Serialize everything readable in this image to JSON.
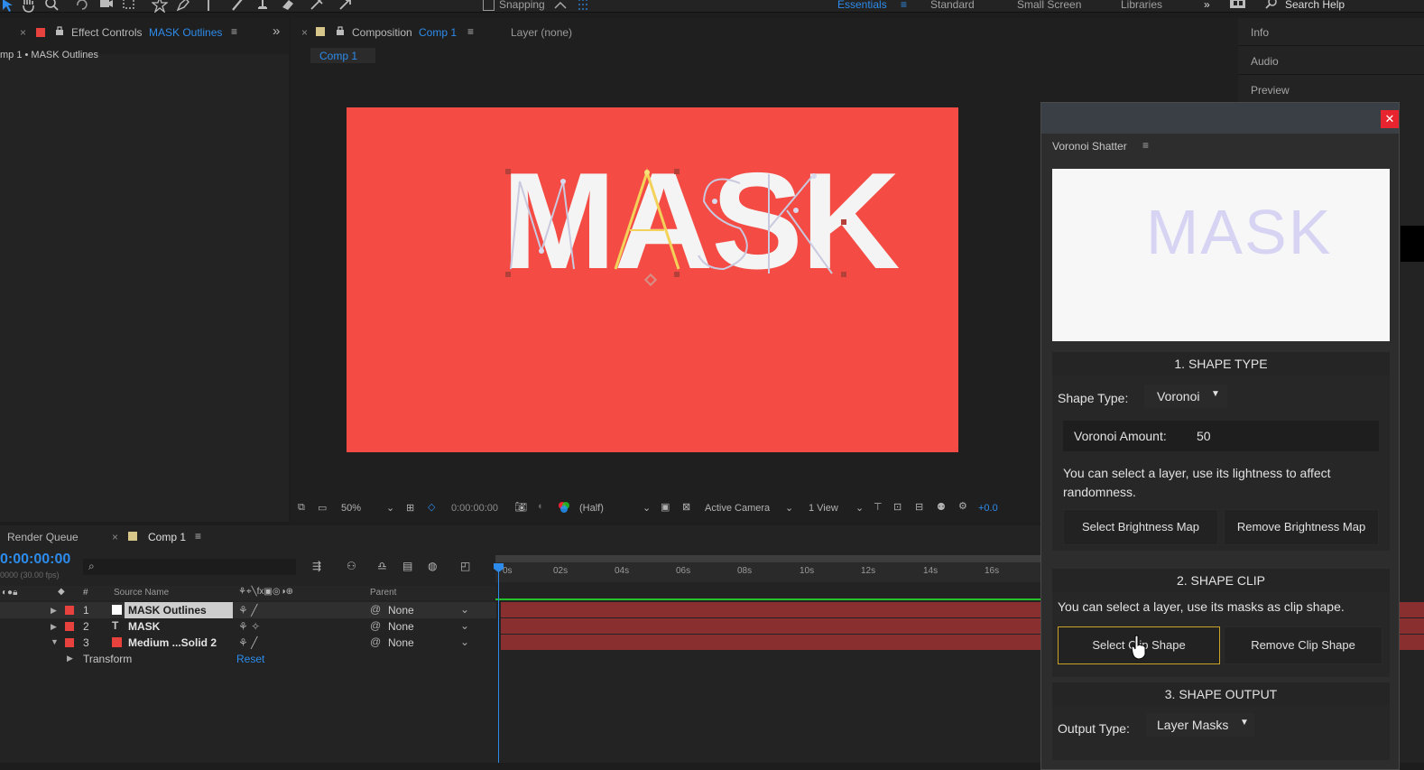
{
  "toolbar": {
    "snapping_label": "Snapping",
    "workspaces": [
      "Essentials",
      "Standard",
      "Small Screen",
      "Libraries"
    ],
    "search_placeholder": "Search Help"
  },
  "effect_controls": {
    "tab_title": "Effect Controls",
    "tab_layer": "MASK Outlines",
    "breadcrumb": "mp 1 • MASK Outlines"
  },
  "composition": {
    "tab_title": "Composition",
    "tab_comp": "Comp 1",
    "layer_tab": "Layer (none)",
    "subtab": "Comp 1",
    "canvas_text": "MASK"
  },
  "viewer_bar": {
    "zoom": "50%",
    "timecode": "0:00:00:00",
    "resolution": "(Half)",
    "camera": "Active Camera",
    "views": "1 View",
    "exposure": "+0.0"
  },
  "timeline": {
    "render_queue_tab": "Render Queue",
    "comp_tab": "Comp 1",
    "current_time": "0:00:00:00",
    "fps_text": "0000 (30.00 fps)",
    "col_source_name": "Source Name",
    "col_parent": "Parent",
    "ruler_ticks": [
      "0s",
      "02s",
      "04s",
      "06s",
      "08s",
      "10s",
      "12s",
      "14s",
      "16s"
    ],
    "layers": [
      {
        "num": "1",
        "type": "",
        "name": "MASK Outlines",
        "parent": "None",
        "color": "#ffffff"
      },
      {
        "num": "2",
        "type": "T",
        "name": "MASK",
        "parent": "None",
        "color": ""
      },
      {
        "num": "3",
        "type": "",
        "name": "Medium ...Solid 2",
        "parent": "None",
        "color": "#e8423f"
      }
    ],
    "transform_label": "Transform",
    "reset_label": "Reset"
  },
  "right_panel": {
    "items": [
      "Info",
      "Audio",
      "Preview"
    ]
  },
  "voronoi": {
    "title": "Voronoi Shatter",
    "preview_text": "MASK",
    "section1": "1. SHAPE TYPE",
    "shape_type_label": "Shape Type:",
    "shape_type_value": "Voronoi",
    "voronoi_amount_label": "Voronoi Amount:",
    "voronoi_amount_value": "50",
    "hint_brightness": "You can select a layer, use its lightness to affect randomness.",
    "select_brightness": "Select Brightness Map",
    "remove_brightness": "Remove Brightness Map",
    "section2": "2. SHAPE CLIP",
    "hint_clip": "You can select a layer, use its masks as clip shape.",
    "select_clip": "Select Clip Shape",
    "remove_clip": "Remove Clip Shape",
    "section3": "3. SHAPE OUTPUT",
    "output_type_label": "Output Type:",
    "output_type_value": "Layer Masks"
  },
  "colors": {
    "accent": "#2d8ceb",
    "canvas_bg": "#f44c45",
    "layer_bar": "#8a2f30",
    "close_button": "#e8252f",
    "highlight_border": "#c9a227"
  }
}
